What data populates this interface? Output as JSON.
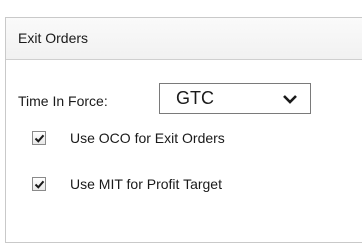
{
  "panel": {
    "title": "Exit Orders"
  },
  "time_in_force": {
    "label": "Time In Force:",
    "selected": "GTC"
  },
  "options": {
    "oco": {
      "label": "Use OCO for Exit Orders",
      "checked": true
    },
    "mit": {
      "label": "Use MIT for Profit Target",
      "checked": true
    }
  }
}
